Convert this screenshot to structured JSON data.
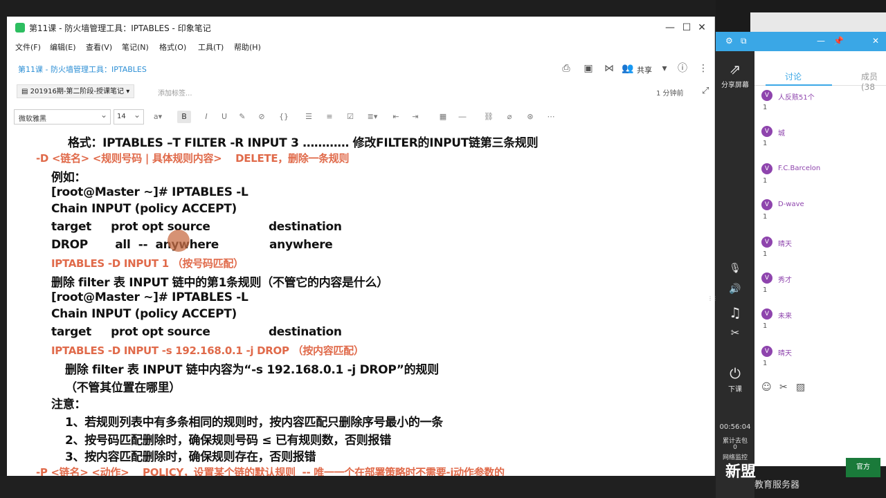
{
  "window": {
    "title": "第11课 - 防火墙管理工具：IPTABLES - 印象笔记",
    "controls": {
      "minimize": "—",
      "maximize": "☐",
      "close": "✕"
    }
  },
  "menu": [
    "文件(F)",
    "编辑(E)",
    "查看(V)",
    "笔记(N)",
    "格式(O)",
    "工具(T)",
    "帮助(H)"
  ],
  "note_header": {
    "title": "第11课 - 防火墙管理工具：IPTABLES",
    "share_label": "共享"
  },
  "notebook": {
    "name": "201916期-第二阶段-授课笔记",
    "add_tag": "添加标签...",
    "modified": "1 分钟前"
  },
  "format_toolbar": {
    "font": "微软雅黑",
    "size": "14"
  },
  "content_lines": [
    {
      "text": "格式：IPTABLES –T FILTER -R INPUT 3 ………… 修改FILTER的INPUT链第三条规则",
      "red": false
    },
    {
      "text": "-D <链名> <规则号码 | 具体规则内容>    DELETE，删除一条规则",
      "red": true
    },
    {
      "text": "例如：",
      "red": false
    },
    {
      "text": "[root@Master ~]# IPTABLES -L",
      "red": false
    },
    {
      "text": "Chain INPUT (policy ACCEPT)",
      "red": false
    },
    {
      "text": "target     prot opt source               destination",
      "red": false
    },
    {
      "text": "DROP       all  --  anywhere             anywhere",
      "red": false
    },
    {
      "text": "IPTABLES -D INPUT 1 （按号码匹配）",
      "red": true
    },
    {
      "text": "删除 filter 表 INPUT 链中的第1条规则（不管它的内容是什么）",
      "red": false
    },
    {
      "text": "[root@Master ~]# IPTABLES -L",
      "red": false
    },
    {
      "text": "Chain INPUT (policy ACCEPT)",
      "red": false
    },
    {
      "text": "target     prot opt source               destination",
      "red": false
    },
    {
      "text": "IPTABLES -D INPUT -s 192.168.0.1 -j DROP （按内容匹配）",
      "red": true
    },
    {
      "text": "删除 filter 表 INPUT 链中内容为“-s 192.168.0.1 -j DROP”的规则",
      "red": false
    },
    {
      "text": "（不管其位置在哪里）",
      "red": false
    },
    {
      "text": "注意：",
      "red": false
    },
    {
      "text": "1、若规则列表中有多条相同的规则时，按内容匹配只删除序号最小的一条",
      "red": false
    },
    {
      "text": "2、按号码匹配删除时，确保规则号码 ≤ 已有规则数，否则报错",
      "red": false
    },
    {
      "text": "3、按内容匹配删除时，确保规则存在，否则报错",
      "red": false
    },
    {
      "text": "-P <链名> <动作>    POLICY，设置某个链的默认规则  -- 唯一一个在部署策略时不需要-j动作参数的",
      "red": true
    }
  ],
  "class_tool": {
    "share_screen": "分享屏幕",
    "end_class": "下课",
    "timer": "00:56:04",
    "stats": [
      "累计去包",
      "0",
      "网络监控"
    ],
    "tabs": [
      "讨论",
      "成员(38"
    ],
    "messages": [
      {
        "name": "人反赅51个",
        "text": "1"
      },
      {
        "name": "城",
        "text": "1"
      },
      {
        "name": "F.C.Barcelon",
        "text": "1"
      },
      {
        "name": "D-wave",
        "text": "1"
      },
      {
        "name": "晴天",
        "text": "1"
      },
      {
        "name": "秀才",
        "text": "1"
      },
      {
        "name": "未来",
        "text": "1"
      },
      {
        "name": "晴天",
        "text": "1"
      }
    ]
  },
  "watermark": {
    "main": "新盟",
    "sub": "教育服务器",
    "badge": "官方"
  }
}
